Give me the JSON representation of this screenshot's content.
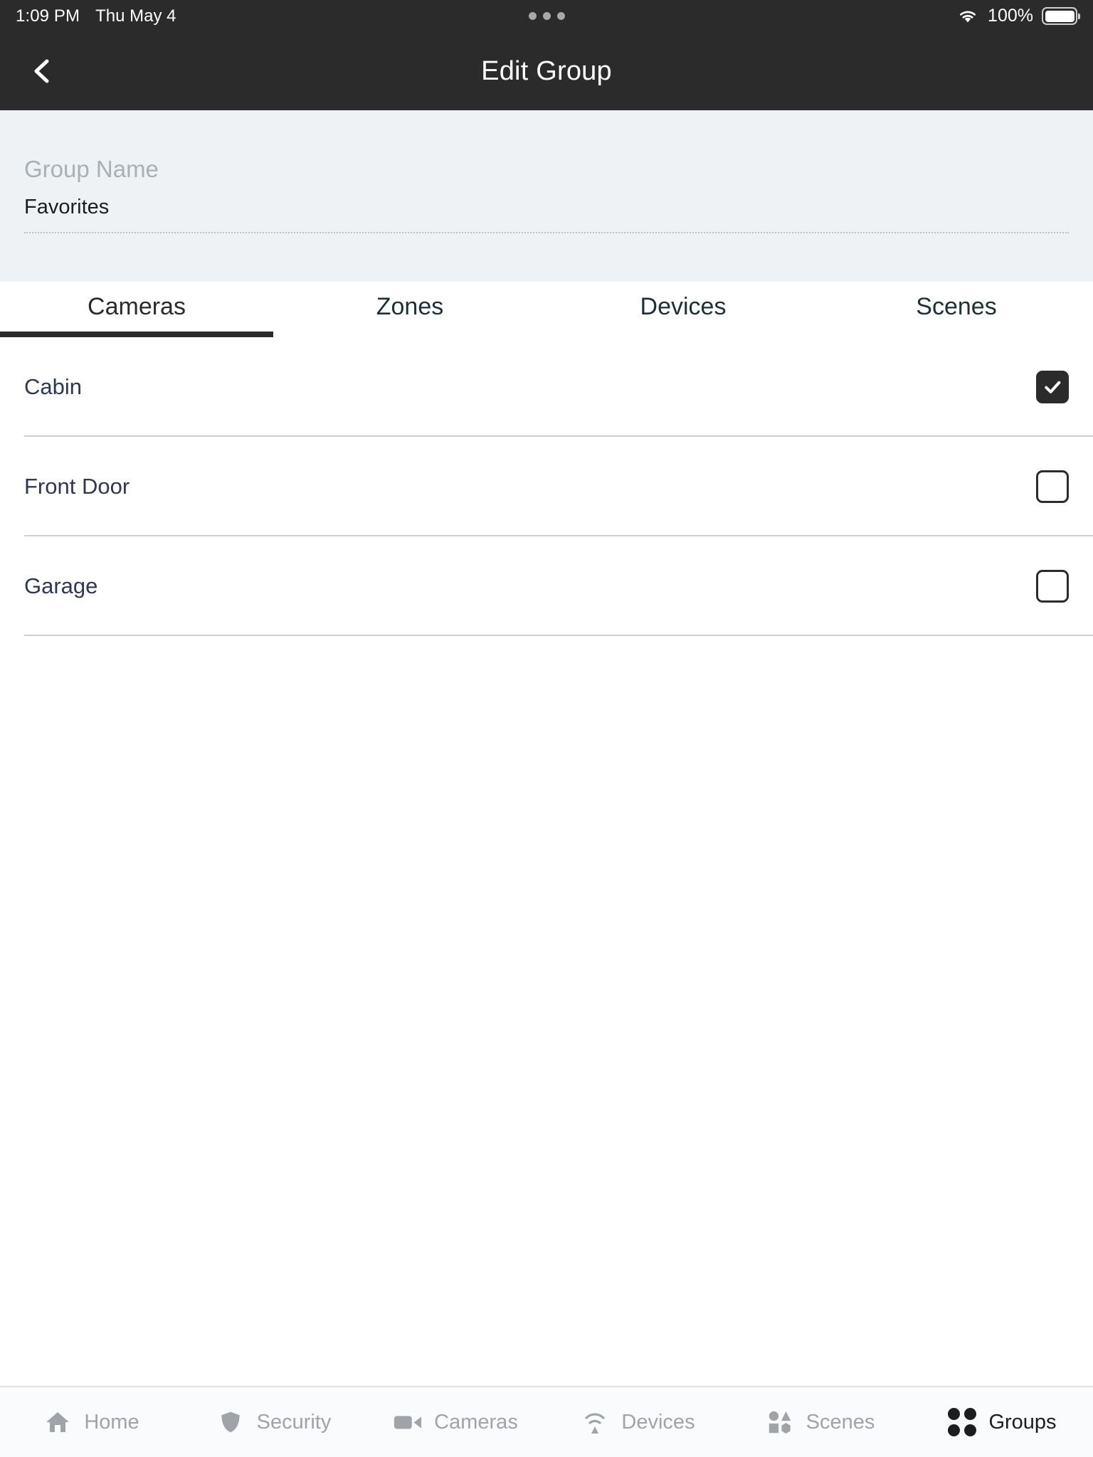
{
  "statusbar": {
    "time": "1:09 PM",
    "date": "Thu May 4",
    "battery_percent": "100%",
    "wifi_icon": "wifi-icon",
    "battery_icon": "battery-full-icon",
    "dots_icon": "three-dots-icon"
  },
  "navbar": {
    "title": "Edit Group",
    "back_icon": "chevron-left-icon"
  },
  "form": {
    "group_name_label": "Group Name",
    "group_name_value": "Favorites",
    "group_name_placeholder": "Group Name"
  },
  "tabs": {
    "active_index": 0,
    "items": [
      {
        "label": "Cameras"
      },
      {
        "label": "Zones"
      },
      {
        "label": "Devices"
      },
      {
        "label": "Scenes"
      }
    ]
  },
  "list": {
    "rows": [
      {
        "label": "Cabin",
        "checked": true
      },
      {
        "label": "Front Door",
        "checked": false
      },
      {
        "label": "Garage",
        "checked": false
      }
    ]
  },
  "tabbar": {
    "active_index": 5,
    "items": [
      {
        "label": "Home",
        "icon": "home-icon"
      },
      {
        "label": "Security",
        "icon": "shield-icon"
      },
      {
        "label": "Cameras",
        "icon": "video-camera-icon"
      },
      {
        "label": "Devices",
        "icon": "signal-icon"
      },
      {
        "label": "Scenes",
        "icon": "shapes-icon"
      },
      {
        "label": "Groups",
        "icon": "groups-dots-icon"
      }
    ]
  },
  "colors": {
    "header_bg": "#2b2b2b",
    "form_bg": "#eef2f5",
    "accent": "#2b2b2b",
    "row_text": "#2e3855",
    "muted": "#a0a4a8"
  }
}
